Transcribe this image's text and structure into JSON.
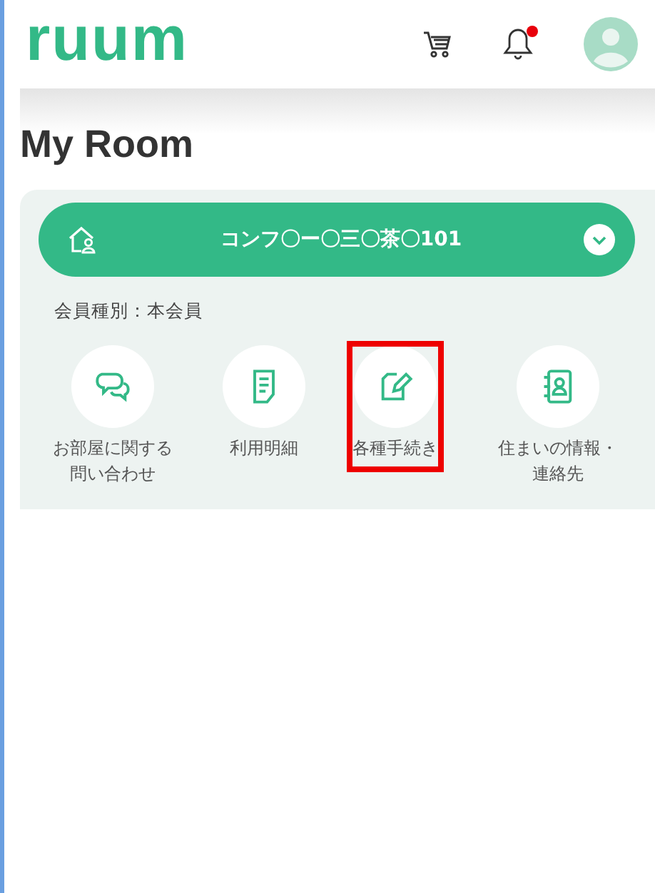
{
  "header": {
    "logo": "ruum",
    "notification_unread": true
  },
  "title": "My Room",
  "property": {
    "name": "コンフ〇ー〇三〇茶〇101"
  },
  "member_type": "会員種別：本会員",
  "menu": [
    {
      "kind": "chat",
      "label": "お部屋に関する問い合わせ",
      "highlighted": false
    },
    {
      "kind": "statement",
      "label": "利用明細",
      "highlighted": false
    },
    {
      "kind": "procedure",
      "label": "各種手続き",
      "highlighted": true
    },
    {
      "kind": "contact",
      "label": "住まいの情報・連絡先",
      "highlighted": false
    }
  ]
}
